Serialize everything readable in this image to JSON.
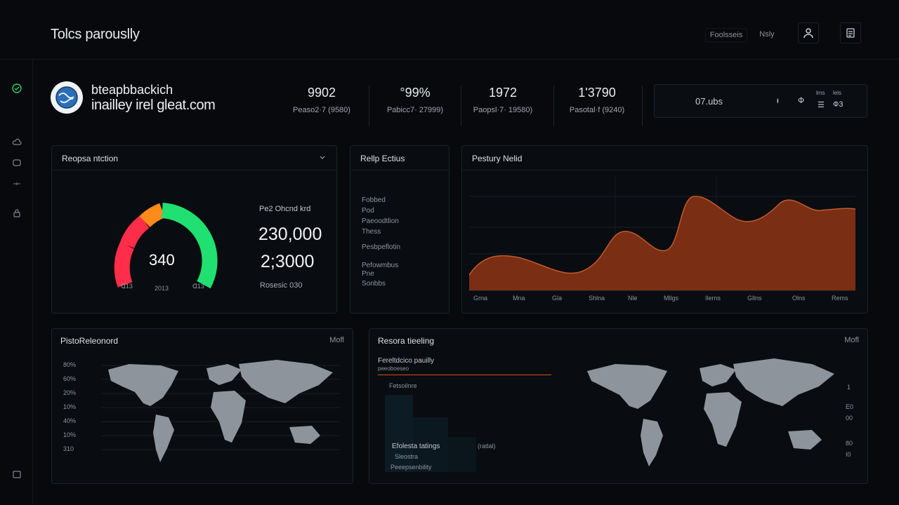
{
  "app": {
    "title": "Tolcs parouslly"
  },
  "topbar": {
    "link1": "Foolsseis",
    "link2": "Nsly",
    "user_icon": "user-icon",
    "doc_icon": "document-icon"
  },
  "sidebar": {
    "icons": [
      "refresh-icon",
      "cloud-icon",
      "chat-icon",
      "filter-icon",
      "lock-icon",
      "folder-icon"
    ]
  },
  "profile": {
    "name": "bteapbbackich",
    "email": "inailley irel gleat.com",
    "avatar_icon": "globe-avatar-icon"
  },
  "stats": [
    {
      "value": "9902",
      "label": "Peaso2·7 (9580)"
    },
    {
      "value": "°99%",
      "label": "Pabicc7· 27999)"
    },
    {
      "value": "1972",
      "label": "Paopsl·7· 19580)"
    },
    {
      "value": "1'3790",
      "label": "Pasotal·f (9240)"
    }
  ],
  "status": {
    "text": "07.ubs",
    "ind1": "ᵻ",
    "ind2": "Ф",
    "mini1": "lms",
    "mini2": "lels",
    "mini3": "☰",
    "mini4": "Ф3"
  },
  "gauge_panel": {
    "title": "Reopsa ntction",
    "dropdown_icon": "chevron-down-icon",
    "value": "340",
    "min_label": "ᗡ13",
    "max_label": "ᗡ13",
    "bottom": "2013",
    "label_top": "Pe2 Ohcnd krd",
    "big1": "230,000",
    "big2": "2;3000",
    "label_bottom": "Rosesic 030",
    "gauge_fraction": 0.78,
    "colors": {
      "red": "#ff2d4a",
      "orange": "#ff8c1a",
      "green": "#1fe071"
    }
  },
  "list_panel": {
    "title": "Rellp Ectius",
    "items": [
      "Fobbed",
      "Pod",
      "Paeoodtlion",
      "Thess",
      "Pesbpeflotin",
      "Pefowmbus",
      "Pne",
      "Sonbbs"
    ]
  },
  "wave_panel": {
    "title": "Pestury Nelid",
    "x_labels": [
      "Grna",
      "Mna",
      "Gla",
      "Shlna",
      "Nle",
      "Mllgs",
      "Ilerns",
      "Gllns",
      "Olns",
      "Rems"
    ],
    "fill_color": "#8a3416",
    "line_color": "#c35a2c"
  },
  "map1_panel": {
    "title": "PistoReleonord",
    "link": "Mofl",
    "y_labels": [
      "80%",
      "60%",
      "20%",
      "10%",
      "40%",
      "10%",
      "310"
    ]
  },
  "map2_panel": {
    "title": "Resora tieeling",
    "link": "Mofl",
    "sub1": "Fereltdcico pauilly",
    "sub2": "peeoboeseo",
    "sub3": "Fetsoilnre",
    "legend1": "Efolesta tatings",
    "legend1b": "(ratlal)",
    "legend2": "Sleostra",
    "legend3": "Peeepsenbility",
    "right_labels": [
      "1",
      "E0",
      "00",
      "80",
      "I0"
    ],
    "accent": "#d2541e"
  }
}
